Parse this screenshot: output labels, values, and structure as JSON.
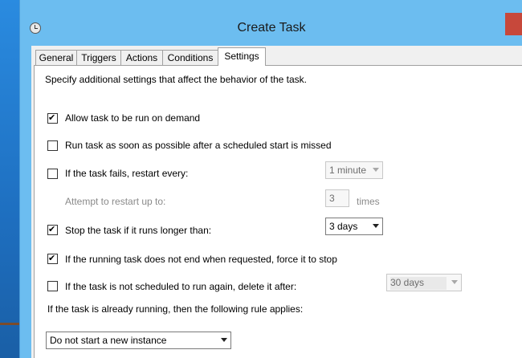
{
  "window": {
    "title": "Create Task"
  },
  "tabs": [
    {
      "label": "General"
    },
    {
      "label": "Triggers"
    },
    {
      "label": "Actions"
    },
    {
      "label": "Conditions"
    },
    {
      "label": "Settings"
    }
  ],
  "active_tab": "Settings",
  "settings": {
    "intro": "Specify additional settings that affect the behavior of the task.",
    "allow_on_demand": {
      "label": "Allow task to be run on demand",
      "checked": true
    },
    "run_asap": {
      "label": "Run task as soon as possible after a scheduled start is missed",
      "checked": false
    },
    "restart_on_fail": {
      "label": "If the task fails, restart every:",
      "checked": false,
      "interval": "1 minute"
    },
    "restart_attempts": {
      "label": "Attempt to restart up to:",
      "value": "3",
      "unit": "times"
    },
    "stop_if_longer": {
      "label": "Stop the task if it runs longer than:",
      "checked": true,
      "value": "3 days"
    },
    "force_stop": {
      "label": "If the running task does not end when requested, force it to stop",
      "checked": true
    },
    "delete_after": {
      "label": "If the task is not scheduled to run again, delete it after:",
      "checked": false,
      "value": "30 days"
    },
    "rule_label": "If the task is already running, then the following rule applies:",
    "rule_value": "Do not start a new instance"
  }
}
